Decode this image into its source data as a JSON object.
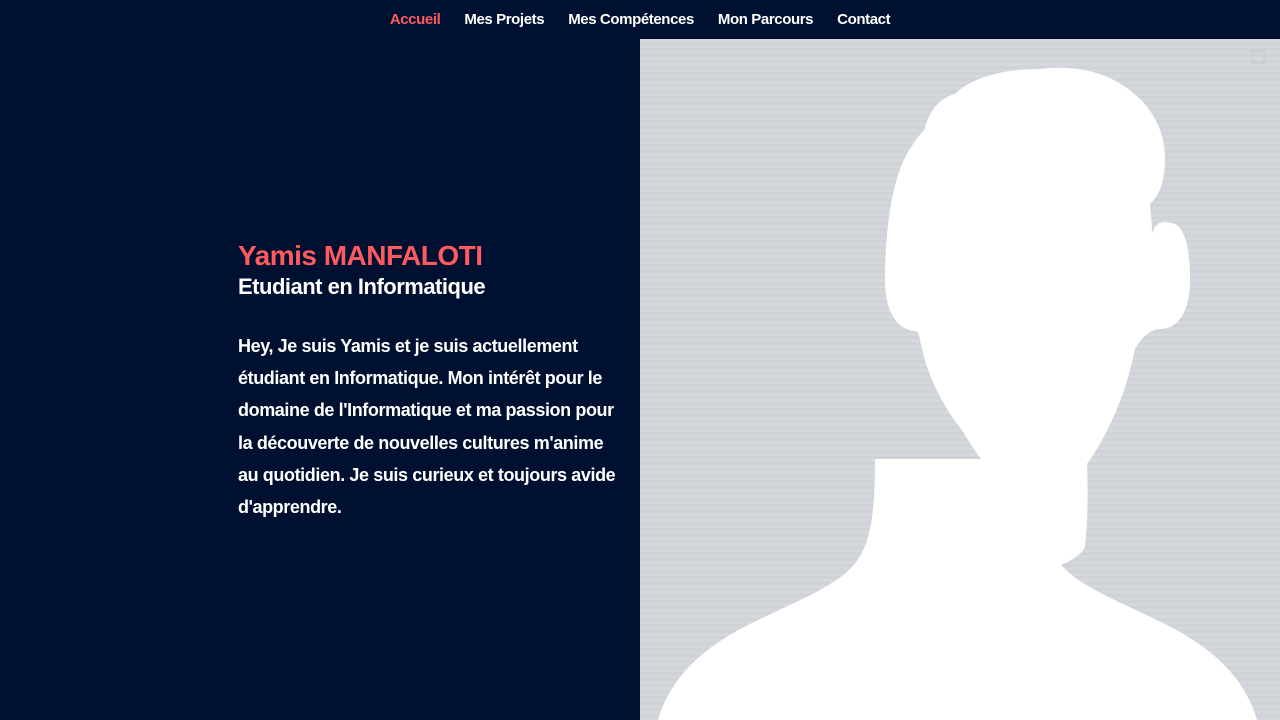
{
  "nav": {
    "items": [
      {
        "label": "Accueil",
        "active": true
      },
      {
        "label": "Mes Projets",
        "active": false
      },
      {
        "label": "Mes Compétences",
        "active": false
      },
      {
        "label": "Mon Parcours",
        "active": false
      },
      {
        "label": "Contact",
        "active": false
      }
    ]
  },
  "hero": {
    "name": "Yamis MANFALOTI",
    "subtitle": "Etudiant en Informatique",
    "bio": "Hey, Je suis Yamis et je suis actuellement étudiant en Informatique. Mon intérêt pour le domaine de l'Informatique et ma passion pour la découverte de nouvelles cultures m'anime au quotidien. Je suis curieux et toujours avide d'apprendre."
  },
  "profile": {
    "icon": "default-avatar-silhouette-icon"
  },
  "colors": {
    "background": "#001030",
    "accent": "#ff5a5f",
    "text": "#ffffff",
    "avatar_bg": "#d4d7dc",
    "avatar_fg": "#ffffff"
  }
}
